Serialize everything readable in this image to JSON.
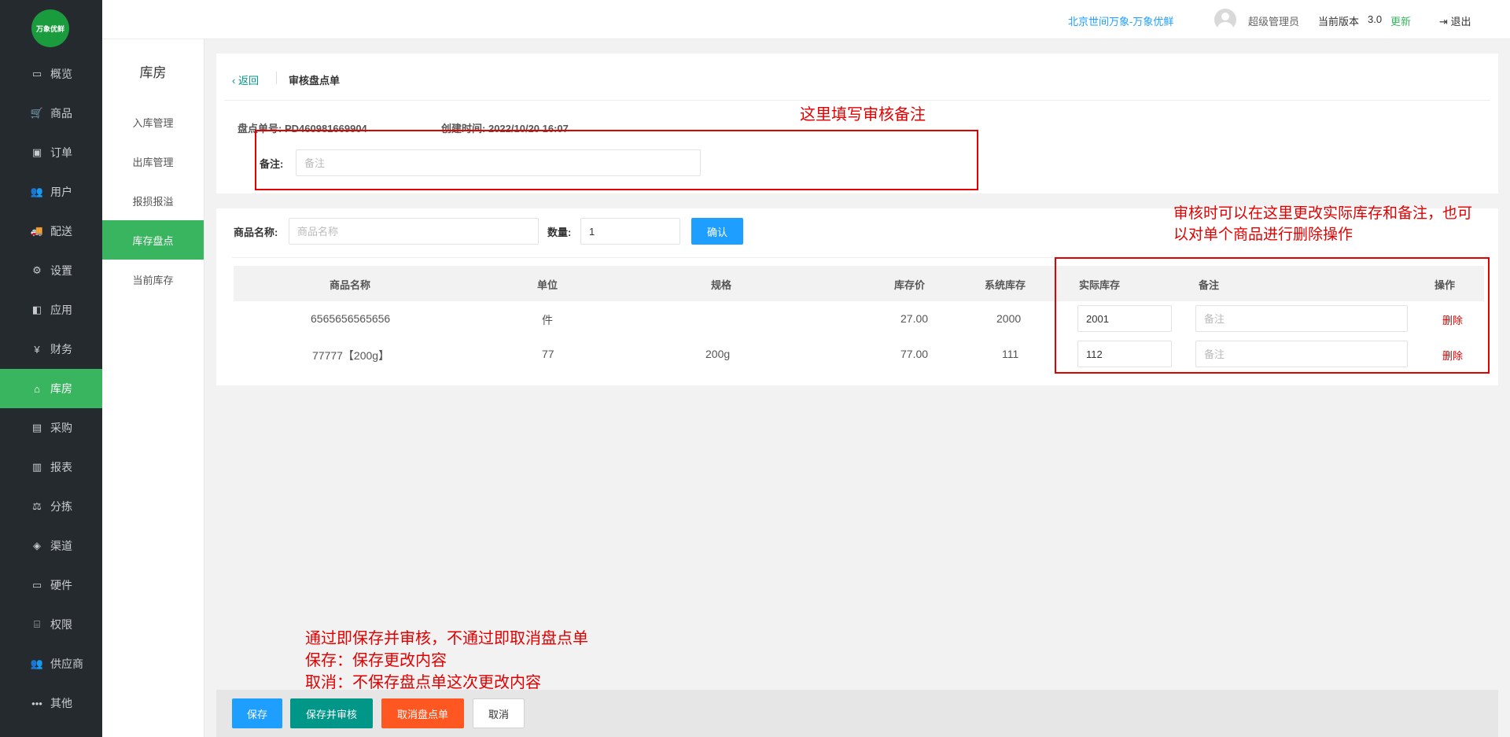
{
  "sidebar": {
    "logo_text": "万象优鲜",
    "items": [
      {
        "label": "概览",
        "icon": "monitor-icon",
        "glyph": "▭"
      },
      {
        "label": "商品",
        "icon": "cart-icon",
        "glyph": "🛒"
      },
      {
        "label": "订单",
        "icon": "money-icon",
        "glyph": "▣"
      },
      {
        "label": "用户",
        "icon": "users-icon",
        "glyph": "👥"
      },
      {
        "label": "配送",
        "icon": "truck-icon",
        "glyph": "🚚"
      },
      {
        "label": "设置",
        "icon": "puzzle-icon",
        "glyph": "⚙"
      },
      {
        "label": "应用",
        "icon": "apps-icon",
        "glyph": "◧"
      },
      {
        "label": "财务",
        "icon": "yen-icon",
        "glyph": "¥"
      },
      {
        "label": "库房",
        "icon": "home-icon",
        "glyph": "⌂",
        "active": true
      },
      {
        "label": "采购",
        "icon": "bus-icon",
        "glyph": "▤"
      },
      {
        "label": "报表",
        "icon": "bar-chart-icon",
        "glyph": "▥"
      },
      {
        "label": "分拣",
        "icon": "scale-icon",
        "glyph": "⚖"
      },
      {
        "label": "渠道",
        "icon": "cube-icon",
        "glyph": "◈"
      },
      {
        "label": "硬件",
        "icon": "desktop-icon",
        "glyph": "▭"
      },
      {
        "label": "权限",
        "icon": "bank-icon",
        "glyph": "⌸"
      },
      {
        "label": "供应商",
        "icon": "group-icon",
        "glyph": "👥"
      },
      {
        "label": "其他",
        "icon": "more-icon",
        "glyph": "•••"
      }
    ]
  },
  "header": {
    "store": "北京世间万象-万象优鲜",
    "user": "超级管理员",
    "version_label": "当前版本",
    "version": "3.0",
    "update": "更新",
    "logout": "退出"
  },
  "subnav": {
    "title": "库房",
    "items": [
      {
        "label": "入库管理"
      },
      {
        "label": "出库管理"
      },
      {
        "label": "报损报溢"
      },
      {
        "label": "库存盘点",
        "active": true
      },
      {
        "label": "当前库存"
      }
    ]
  },
  "top": {
    "back": "返回",
    "title": "审核盘点单",
    "order_no_label": "盘点单号:",
    "order_no": "PD460981669904",
    "created_label": "创建时间:",
    "created": "2022/10/20 16:07",
    "remark_label": "备注:",
    "remark_placeholder": "备注"
  },
  "filter": {
    "name_label": "商品名称:",
    "name_placeholder": "商品名称",
    "qty_label": "数量:",
    "qty_value": "1",
    "confirm": "确认"
  },
  "table": {
    "headers": [
      "商品名称",
      "单位",
      "规格",
      "库存价",
      "系统库存",
      "实际库存",
      "备注",
      "操作"
    ],
    "rows": [
      {
        "name": "6565656565656",
        "unit": "件",
        "spec": "",
        "price": "27.00",
        "sys_stock": "2000",
        "actual": "2001",
        "remark_placeholder": "备注",
        "action": "删除"
      },
      {
        "name": "77777【200g】",
        "unit": "77",
        "spec": "200g",
        "price": "77.00",
        "sys_stock": "111",
        "actual": "112",
        "remark_placeholder": "备注",
        "action": "删除"
      }
    ]
  },
  "annotations": {
    "remark": "这里填写审核备注",
    "table_line1": "审核时可以在这里更改实际库存和备注，也可",
    "table_line2": "以对单个商品进行删除操作",
    "footer_line1": "通过即保存并审核，不通过即取消盘点单",
    "footer_line2": "保存：保存更改内容",
    "footer_line3": "取消：不保存盘点单这次更改内容"
  },
  "footer": {
    "save": "保存",
    "save_approve": "保存并审核",
    "void": "取消盘点单",
    "cancel": "取消"
  },
  "colors": {
    "sidebar_bg": "#252a2f",
    "active_green": "#3ab55f",
    "primary_blue": "#1e9fff",
    "teal": "#009688",
    "orange": "#ff5722",
    "annotation_red": "#e30000"
  }
}
